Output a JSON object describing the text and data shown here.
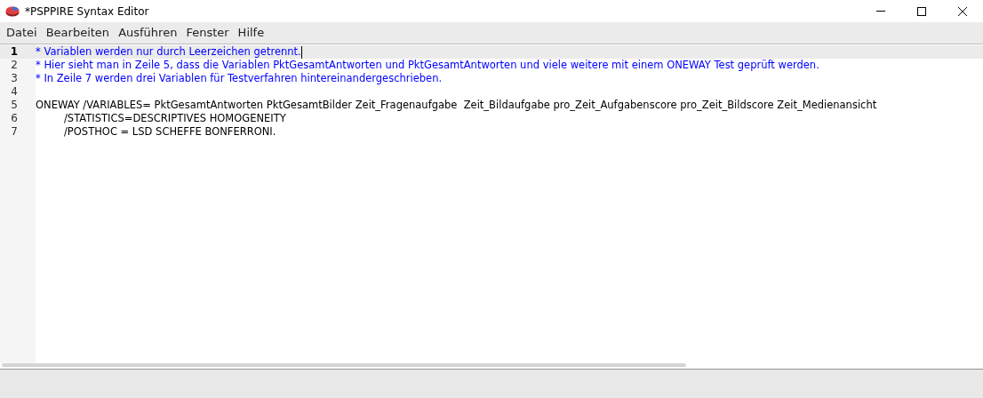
{
  "window": {
    "title": "*PSPPIRE Syntax Editor"
  },
  "menu": [
    {
      "label": "Datei"
    },
    {
      "label": "Bearbeiten"
    },
    {
      "label": "Ausführen"
    },
    {
      "label": "Fenster"
    },
    {
      "label": "Hilfe"
    }
  ],
  "editor": {
    "lines": [
      {
        "number": "1",
        "kind": "comment",
        "text": "* Variablen werden nur durch Leerzeichen getrennt.",
        "selected": true
      },
      {
        "number": "2",
        "kind": "comment",
        "text": "* Hier sieht man in Zeile 5, dass die Variablen PktGesamtAntworten und PktGesamtAntworten und viele weitere mit einem ONEWAY Test geprüft werden.",
        "selected": false
      },
      {
        "number": "3",
        "kind": "comment",
        "text": "* In Zeile 7 werden drei Variablen für Testverfahren hintereinandergeschrieben.",
        "selected": false
      },
      {
        "number": "4",
        "kind": "blank",
        "selected": false
      },
      {
        "number": "5",
        "kind": "code",
        "text": "ONEWAY /VARIABLES= PktGesamtAntworten PktGesamtBilder Zeit_Fragenaufgabe  Zeit_Bildaufgabe pro_Zeit_Aufgabenscore pro_Zeit_Bildscore Zeit_Medienansicht",
        "selected": false
      },
      {
        "number": "6",
        "kind": "subcommand",
        "text": "/STATISTICS=DESCRIPTIVES HOMOGENEITY",
        "selected": false
      },
      {
        "number": "7",
        "kind": "subcommand",
        "text": "/POSTHOC = LSD SCHEFFE BONFERRONI.",
        "selected": false
      }
    ]
  }
}
